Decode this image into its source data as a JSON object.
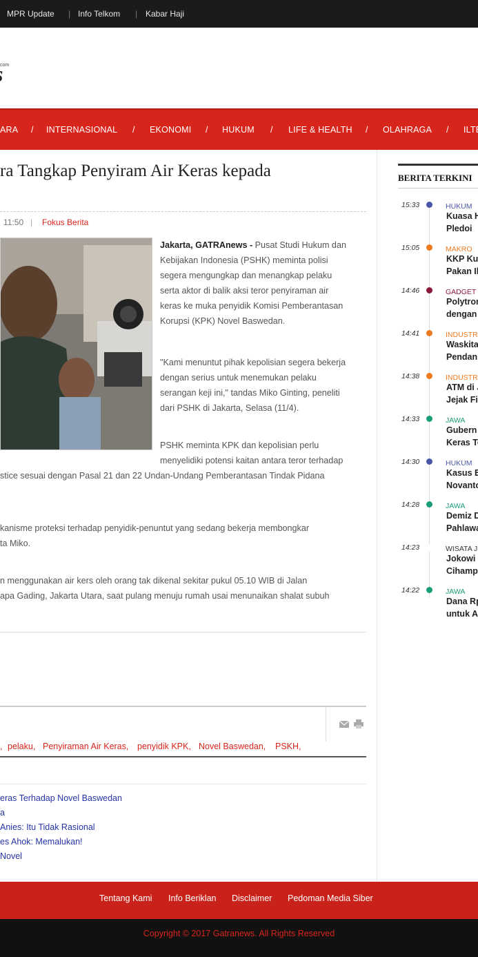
{
  "topbar": {
    "links": [
      "MPR Update",
      "Info Telkom",
      "Kabar Haji"
    ]
  },
  "logo": {
    "com": "com",
    "word": "s"
  },
  "nav": {
    "items": [
      "ARA",
      "INTERNASIONAL",
      "EKONOMI",
      "HUKUM",
      "LIFE & HEALTH",
      "OLAHRAGA",
      "ILTE"
    ]
  },
  "article": {
    "title": "ra Tangkap Penyiram Air Keras kepada",
    "time": "11:50",
    "category": "Fokus Berita",
    "p1": {
      "lead": "Jakarta, GATRAnews -",
      "lines": [
        " Pusat Studi Hukum dan",
        "Kebijakan Indonesia (PSHK) meminta polisi",
        "segera mengungkap dan menangkap pelaku",
        "serta aktor di balik aksi teror penyiraman air",
        "keras ke muka penyidik Komisi Pemberantasan",
        "Korupsi (KPK) Novel Baswedan."
      ]
    },
    "p2": [
      "\"Kami menuntut pihak kepolisian segera bekerja",
      "dengan serius untuk menemukan pelaku",
      "serangan keji ini,\" tandas Miko Ginting, peneliti",
      "dari PSHK di Jakarta, Selasa (11/4)."
    ],
    "p3": [
      "PSHK meminta KPK dan kepolisian perlu",
      "menyelidiki potensi kaitan antara teror terhadap",
      "stice sesuai dengan Pasal 21 dan 22 Undan-Undang Pemberantasan Tindak Pidana"
    ],
    "p4": [
      "kanisme proteksi terhadap penyidik-penuntut yang sedang bekerja membongkar",
      "ta Miko."
    ],
    "p5": [
      "n menggunakan air kers oleh orang tak dikenal sekitar pukul 05.10 WIB di Jalan",
      "apa Gading, Jakarta Utara, saat pulang menuju rumah usai menunaikan shalat subuh"
    ]
  },
  "share": {
    "mail_icon": "envelope-icon",
    "print_icon": "printer-icon"
  },
  "tags": [
    ",",
    "pelaku,",
    "Penyiraman Air Keras,",
    "penyidik KPK,",
    "Novel Baswedan,",
    "PSKH,"
  ],
  "related": [
    "eras Terhadap Novel Baswedan",
    "a",
    "Anies: Itu Tidak Rasional",
    "es Ahok: Memalukan!",
    "Novel"
  ],
  "sidebar": {
    "title": "BERITA TERKINI",
    "items": [
      {
        "time": "15:33",
        "cat": "HUKUM",
        "color": "#4a56a8",
        "l1": "Kuasa H",
        "l2": "Pledoi"
      },
      {
        "time": "15:05",
        "cat": "MAKRO",
        "color": "#ee7a1f",
        "l1": "KKP Kul",
        "l2": "Pakan Il"
      },
      {
        "time": "14:46",
        "cat": "GADGET",
        "color": "#8b1a3a",
        "l1": "Polytron",
        "l2": "dengan"
      },
      {
        "time": "14:41",
        "cat": "INDUSTR",
        "color": "#ee7a1f",
        "l1": "Waskita",
        "l2": "Pendan"
      },
      {
        "time": "14:38",
        "cat": "INDUSTR",
        "color": "#ee7a1f",
        "l1": "ATM di J",
        "l2": "Jejak Fi"
      },
      {
        "time": "14:33",
        "cat": "JAWA",
        "color": "#1a9e7a",
        "l1": "Gubern",
        "l2": "Keras Te"
      },
      {
        "time": "14:30",
        "cat": "HUKUM",
        "color": "#4a56a8",
        "l1": "Kasus E",
        "l2": "Novanto"
      },
      {
        "time": "14:28",
        "cat": "JAWA",
        "color": "#1a9e7a",
        "l1": "Demiz D",
        "l2": "Pahlawa"
      },
      {
        "time": "14:23",
        "cat": "WISATA J",
        "color": "#ffffff",
        "l1": "Jokowi",
        "l2": "Cihamp"
      },
      {
        "time": "14:22",
        "cat": "JAWA",
        "color": "#1a9e7a",
        "l1": "Dana Rp",
        "l2": "untuk A"
      }
    ]
  },
  "footer": {
    "links": [
      "Tentang Kami",
      "Info Beriklan",
      "Disclaimer",
      "Pedoman Media Siber"
    ]
  },
  "copyright": "Copyright © 2017 Gatranews. All Rights Reserved"
}
